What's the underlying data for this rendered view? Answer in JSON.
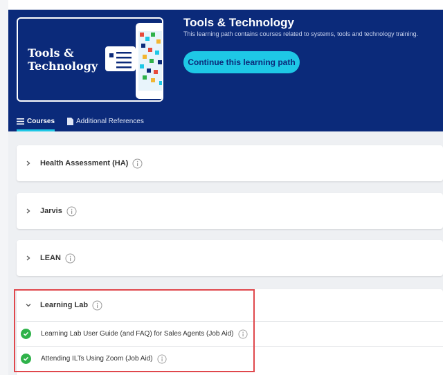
{
  "banner": {
    "thumbnail_title": "Tools &\nTechnology",
    "title": "Tools & Technology",
    "description": "This learning path contains courses related to systems, tools and technology training.",
    "continue_label": "Continue this learning path"
  },
  "tabs": [
    {
      "label": "Courses",
      "icon": "list-icon",
      "active": true
    },
    {
      "label": "Additional References",
      "icon": "document-icon",
      "active": false
    }
  ],
  "courses": [
    {
      "title": "Health Assessment (HA)",
      "expanded": false
    },
    {
      "title": "Jarvis",
      "expanded": false
    },
    {
      "title": "LEAN",
      "expanded": false
    },
    {
      "title": "Learning Lab",
      "expanded": true,
      "items": [
        {
          "title": "Learning Lab User Guide (and FAQ) for Sales Agents (Job Aid)",
          "status": "complete"
        },
        {
          "title": "Attending ILTs Using Zoom (Job Aid)",
          "status": "complete"
        }
      ]
    }
  ],
  "colors": {
    "banner_bg": "#0b2a7a",
    "accent": "#1ec8e6",
    "complete": "#2fb24a",
    "highlight": "#e0474c"
  }
}
